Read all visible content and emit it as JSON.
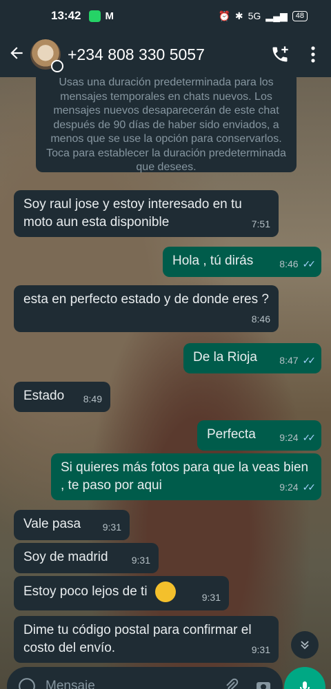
{
  "status_bar": {
    "time": "13:42",
    "app_letter": "M",
    "network": "5G",
    "battery": "48"
  },
  "header": {
    "contact_name": "+234 808 330 5057",
    "back_icon": "arrow-left-icon",
    "call_icon": "add-call-icon",
    "menu_icon": "more-vertical-icon"
  },
  "system_notice": "Usas una duración predeterminada para los mensajes temporales en chats nuevos. Los mensajes nuevos desaparecerán de este chat después de 90 días de haber sido enviados, a menos que se use la opción para conservarlos. Toca para establecer la duración predeterminada que desees.",
  "messages": [
    {
      "dir": "in",
      "text": "Soy raul jose y estoy interesado en tu moto aun esta disponible",
      "time": "7:51"
    },
    {
      "dir": "out",
      "text": "Hola , tú dirás",
      "time": "8:46"
    },
    {
      "dir": "in",
      "text": "esta en perfecto estado y de donde eres ?",
      "time": "8:46"
    },
    {
      "dir": "out",
      "text": "De la Rioja",
      "time": "8:47"
    },
    {
      "dir": "in",
      "text": "Estado",
      "time": "8:49"
    },
    {
      "dir": "out",
      "text": "Perfecta",
      "time": "9:24"
    },
    {
      "dir": "out",
      "text": "Si quieres más fotos para que la veas bien , te paso por aqui",
      "time": "9:24"
    },
    {
      "dir": "in",
      "text": "Vale pasa",
      "time": "9:31"
    },
    {
      "dir": "in",
      "text": "Soy de madrid",
      "time": "9:31"
    },
    {
      "dir": "in",
      "text": "Estoy poco lejos de ti",
      "time": "9:31",
      "emoji": "thinking-face-icon"
    },
    {
      "dir": "in",
      "text": "Dime tu código postal para confirmar el costo del envío.",
      "time": "9:31"
    }
  ],
  "composer": {
    "placeholder": "Mensaje"
  },
  "colors": {
    "incoming": "#1f2c34",
    "outgoing": "#005c4b",
    "accent": "#00a884",
    "read_ticks": "#a3d3ff"
  }
}
